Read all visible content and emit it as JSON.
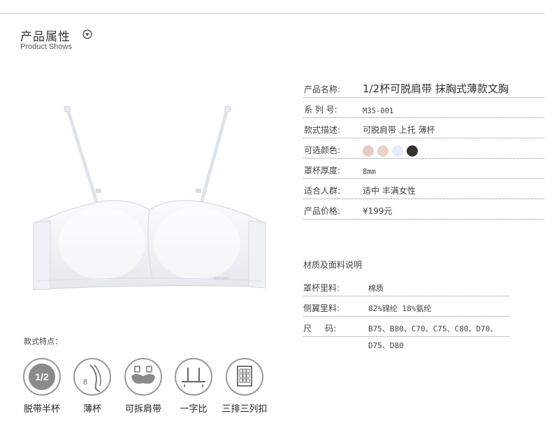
{
  "header": {
    "title": "产品属性",
    "subtitle": "Product Shows",
    "icon": "chevron-circle-down-icon"
  },
  "specs": {
    "name": {
      "label": "产品名称:",
      "value": "1/2杯可脱肩带 抹胸式薄款文胸"
    },
    "series": {
      "label": "系 列 号:",
      "value": "M35-001"
    },
    "style": {
      "label": "款式描述:",
      "value": "可脱肩带 上托 薄杯"
    },
    "colors": {
      "label": "可选颜色:",
      "swatches": [
        "#e9c9c4",
        "#ead3c9",
        "#e6ecf6",
        "#333333"
      ]
    },
    "thickness": {
      "label": "罩杯厚度:",
      "value": "8mm"
    },
    "audience": {
      "label": "适合人群:",
      "value": "适中 丰满女性"
    },
    "price": {
      "label": "产品价格:",
      "value": "¥199元"
    }
  },
  "materials": {
    "title": "材质及面料说明",
    "cup": {
      "label": "罩杯里料:",
      "value": "棉质"
    },
    "wing": {
      "label": "侧翼里料:",
      "value": "82%锦纶 18%氨纶"
    },
    "size": {
      "label": "尺     码:",
      "value": "B75、B80、C70、C75、C80、D70、",
      "value2": "D75、D80"
    }
  },
  "features": {
    "title": "款式特点：",
    "items": [
      {
        "label": "脱带半杯",
        "icon": "half-cup-icon",
        "icon_text": "1/2"
      },
      {
        "label": "薄杯",
        "icon": "thin-cup-icon",
        "icon_text": "8"
      },
      {
        "label": "可拆肩带",
        "icon": "detachable-strap-icon"
      },
      {
        "label": "一字比",
        "icon": "straight-back-icon"
      },
      {
        "label": "三排三列扣",
        "icon": "hook-grid-icon"
      }
    ]
  },
  "product_image": {
    "brand_tag": "ODYSSEY"
  }
}
